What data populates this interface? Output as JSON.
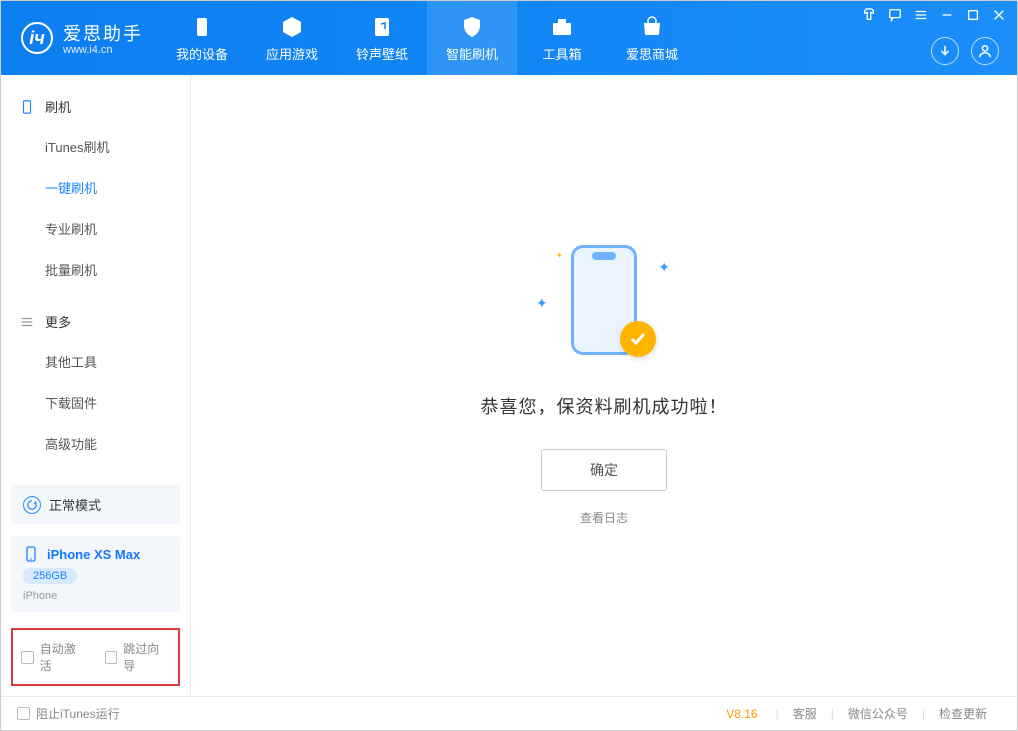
{
  "app": {
    "name_zh": "爱思助手",
    "name_en": "www.i4.cn"
  },
  "nav": {
    "items": [
      {
        "label": "我的设备"
      },
      {
        "label": "应用游戏"
      },
      {
        "label": "铃声壁纸"
      },
      {
        "label": "智能刷机"
      },
      {
        "label": "工具箱"
      },
      {
        "label": "爱思商城"
      }
    ]
  },
  "sidebar": {
    "section1": {
      "title": "刷机"
    },
    "items1": [
      {
        "label": "iTunes刷机"
      },
      {
        "label": "一键刷机"
      },
      {
        "label": "专业刷机"
      },
      {
        "label": "批量刷机"
      }
    ],
    "section2": {
      "title": "更多"
    },
    "items2": [
      {
        "label": "其他工具"
      },
      {
        "label": "下载固件"
      },
      {
        "label": "高级功能"
      }
    ],
    "mode": {
      "label": "正常模式"
    },
    "device": {
      "name": "iPhone XS Max",
      "capacity": "256GB",
      "type": "iPhone"
    },
    "options": {
      "auto_activate": "自动激活",
      "skip_guide": "跳过向导"
    }
  },
  "main": {
    "success_message": "恭喜您，保资料刷机成功啦！",
    "ok_button": "确定",
    "view_log": "查看日志"
  },
  "footer": {
    "block_itunes": "阻止iTunes运行",
    "version": "V8.16",
    "links": {
      "service": "客服",
      "wechat": "微信公众号",
      "update": "检查更新"
    }
  }
}
